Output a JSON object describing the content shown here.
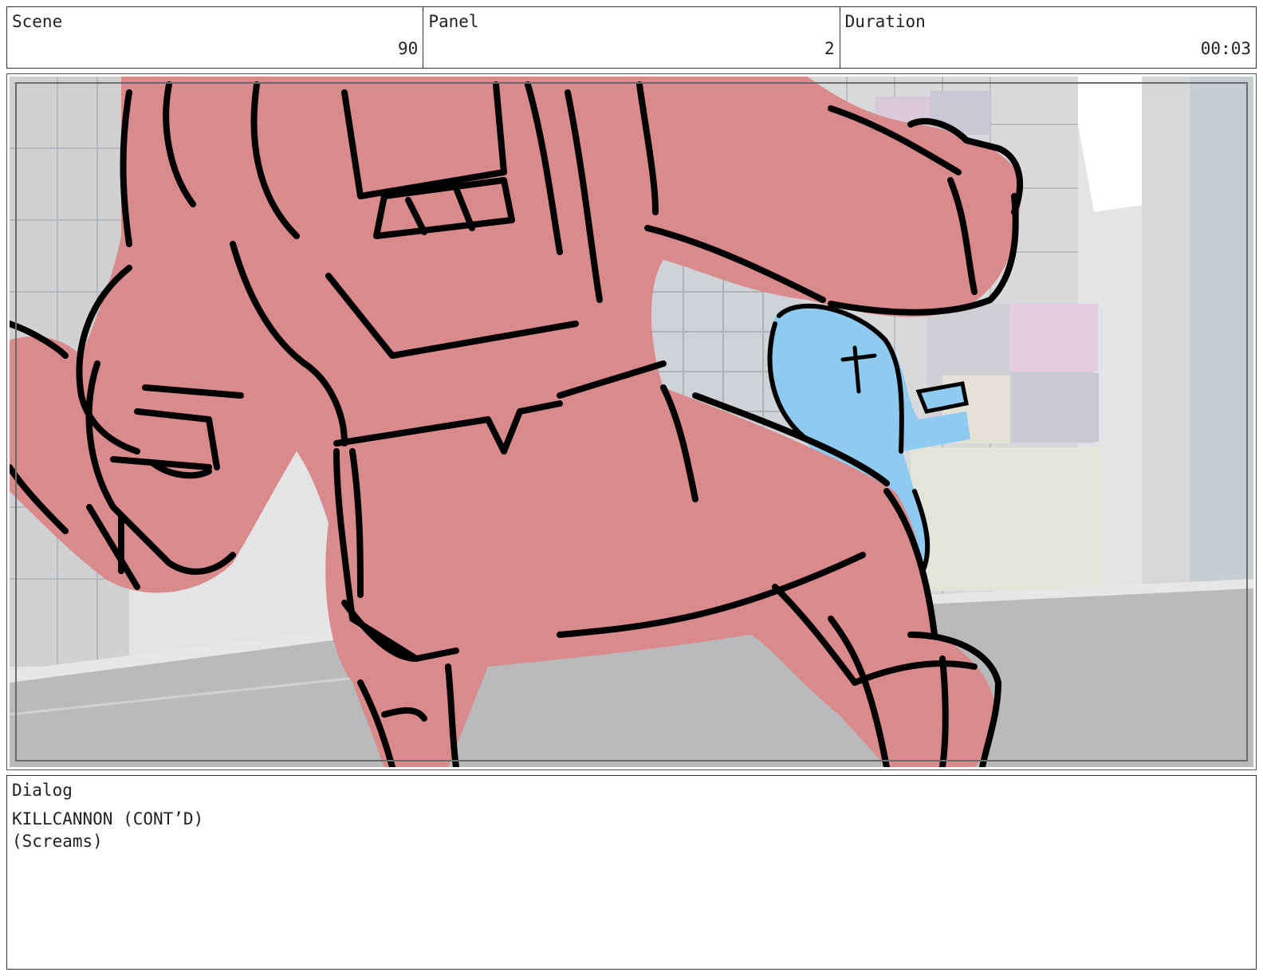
{
  "header": {
    "scene": {
      "label": "Scene",
      "value": "90"
    },
    "panel": {
      "label": "Panel",
      "value": "2"
    },
    "duration": {
      "label": "Duration",
      "value": "00:03"
    }
  },
  "frame": {
    "description_icon": "storyboard-sketch-icon",
    "colors": {
      "sky": "#ffffff",
      "buildings": "#d4d6d8",
      "street": "#b9babc",
      "character_red": "#d98a8b",
      "character_blue": "#8fcbf0",
      "ink": "#000000"
    }
  },
  "dialog": {
    "label": "Dialog",
    "character": "KILLCANNON (CONT’D)",
    "parenthetical": "(Screams)"
  }
}
